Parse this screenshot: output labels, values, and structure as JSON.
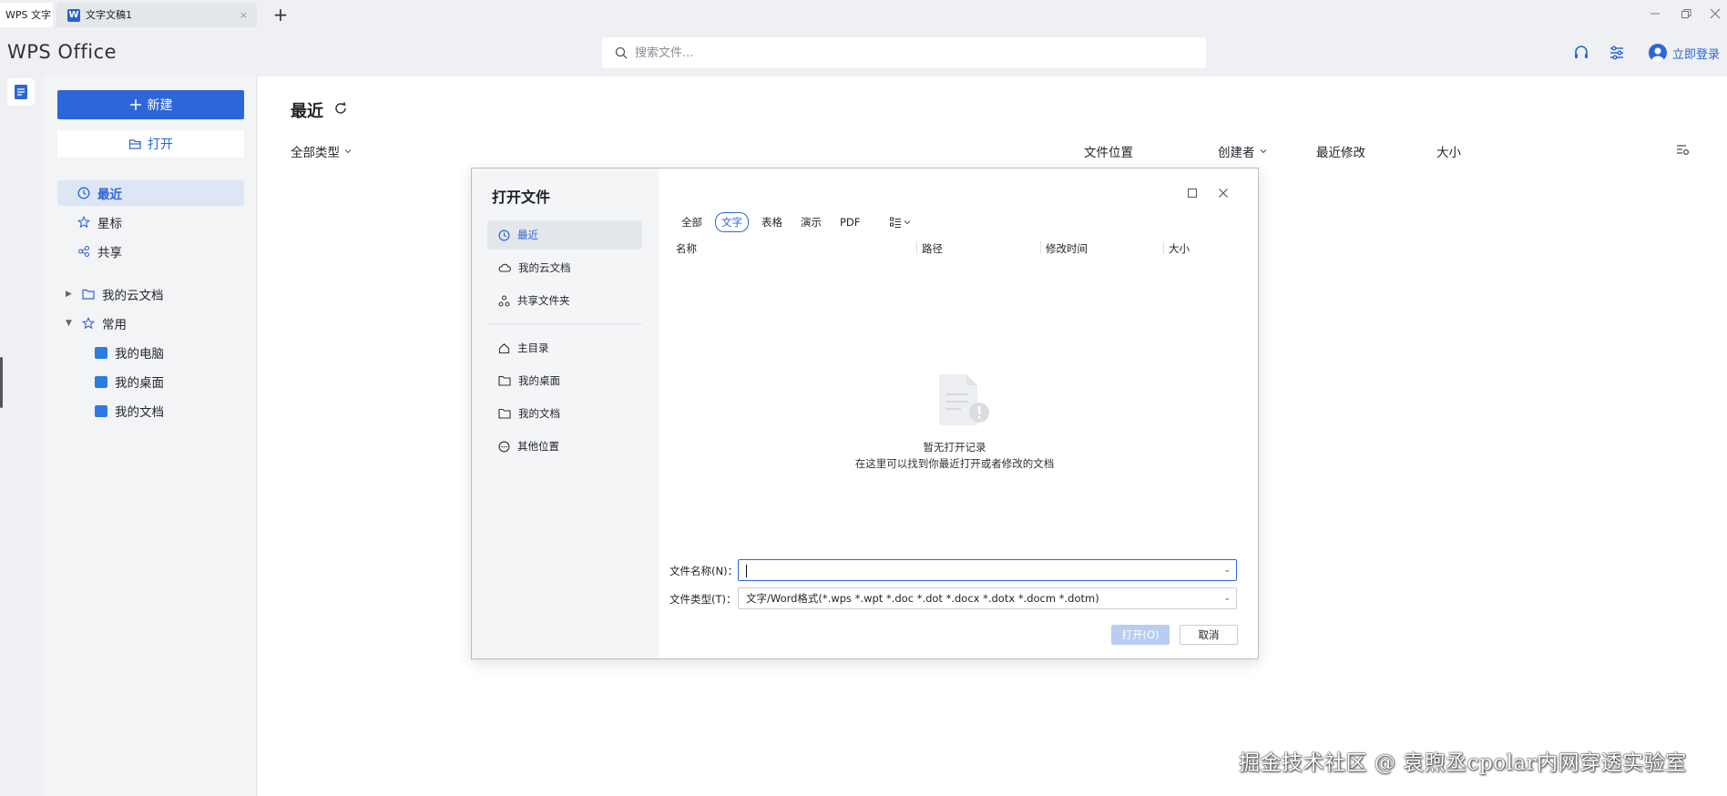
{
  "titlebar": {
    "home_tab": "WPS 文字",
    "doc_tab": "文字文稿1",
    "doc_tab_icon": "W",
    "doc_tab_close": "×",
    "new_tab": "+"
  },
  "header": {
    "logo": "WPS Office",
    "search_placeholder": "搜索文件...",
    "login_label": "立即登录"
  },
  "sidebar": {
    "new_label": "新建",
    "open_label": "打开",
    "nav": [
      {
        "label": "最近"
      },
      {
        "label": "星标"
      },
      {
        "label": "共享"
      }
    ],
    "tree": [
      {
        "label": "我的云文档"
      },
      {
        "label": "常用"
      },
      {
        "label": "我的电脑"
      },
      {
        "label": "我的桌面"
      },
      {
        "label": "我的文档"
      }
    ]
  },
  "main": {
    "title": "最近",
    "filter_all_types": "全部类型",
    "columns": {
      "location": "文件位置",
      "creator": "创建者",
      "modified": "最近修改",
      "size": "大小"
    }
  },
  "dialog": {
    "title": "打开文件",
    "nav": [
      {
        "label": "最近"
      },
      {
        "label": "我的云文档"
      },
      {
        "label": "共享文件夹"
      },
      {
        "label": "主目录"
      },
      {
        "label": "我的桌面"
      },
      {
        "label": "我的文档"
      },
      {
        "label": "其他位置"
      }
    ],
    "filters": [
      "全部",
      "文字",
      "表格",
      "演示",
      "PDF"
    ],
    "selected_filter": "文字",
    "table_headers": [
      "名称",
      "路径",
      "修改时间",
      "大小"
    ],
    "empty_title": "暂无打开记录",
    "empty_desc": "在这里可以找到你最近打开或者修改的文档",
    "filename_label": "文件名称(N)：",
    "filename_value": "",
    "filetype_label": "文件类型(T)：",
    "filetype_value": "文字/Word格式(*.wps *.wpt *.doc *.dot *.docx *.dotx *.docm *.dotm)",
    "open_button": "打开(O)",
    "cancel_button": "取消"
  },
  "watermark": "掘金技术社区 @ 袁煦丞cpolar内网穿透实验室",
  "colors": {
    "accent": "#2c66d9",
    "sidebar_bg": "#f3f4f6",
    "active_nav_bg": "#dde6f5"
  }
}
